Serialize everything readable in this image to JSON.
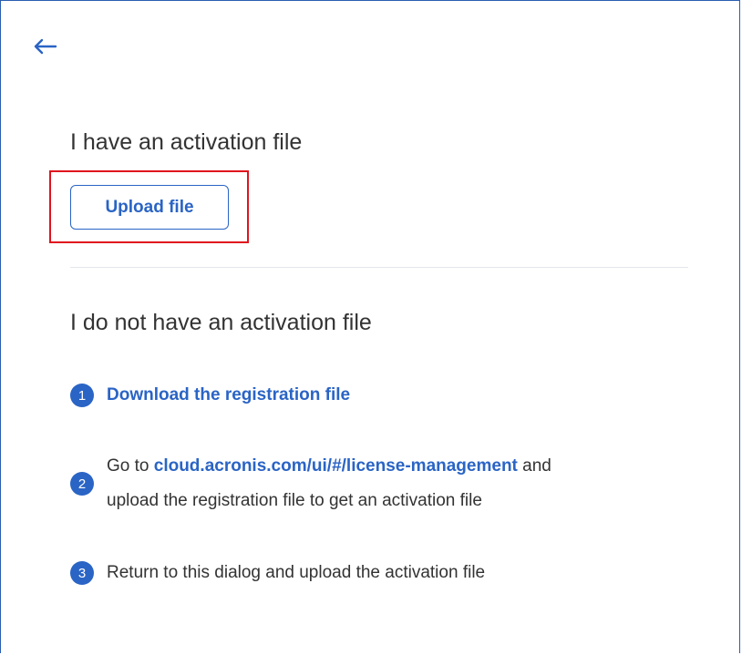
{
  "colors": {
    "accent": "#2a64c5",
    "highlight_border": "#e0141e",
    "frame_border": "#2a5db0",
    "text": "#333333"
  },
  "header": {
    "back_icon": "arrow-left-icon"
  },
  "have_file": {
    "title": "I have an activation file",
    "upload_label": "Upload file"
  },
  "no_file": {
    "title": "I do not have an activation file",
    "steps": [
      {
        "number": "1",
        "link": "Download the registration file"
      },
      {
        "number": "2",
        "prefix": "Go to ",
        "link": "cloud.acronis.com/ui/#/license-management",
        "suffix": " and",
        "line2": "upload the registration file to get an activation file"
      },
      {
        "number": "3",
        "text": "Return to this dialog and upload the activation file"
      }
    ]
  }
}
